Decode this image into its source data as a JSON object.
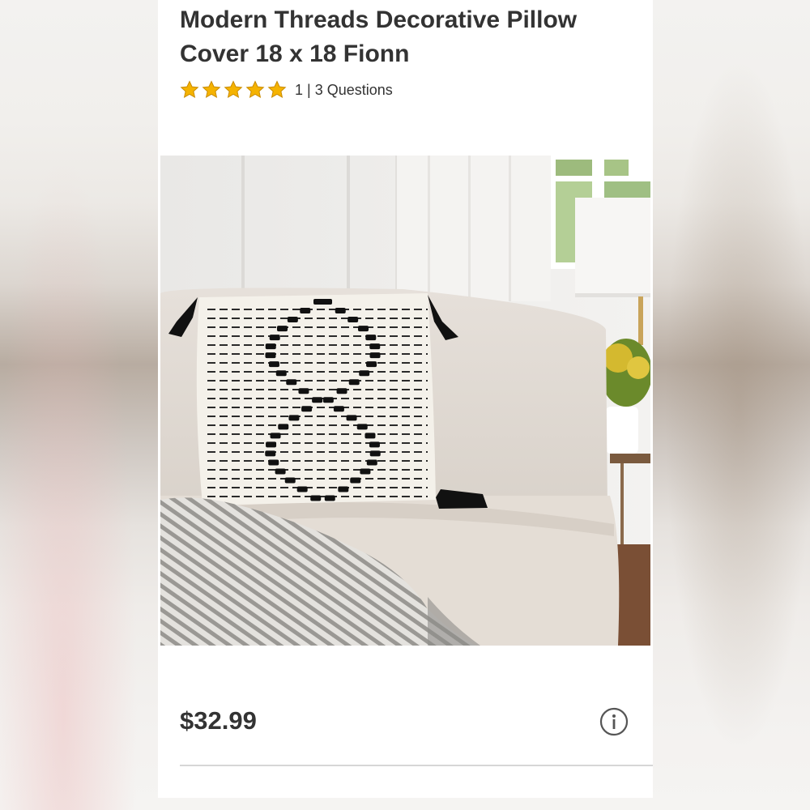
{
  "product": {
    "title": "Modern Threads Decorative Pillow Cover 18 x 18 Fionn",
    "rating": {
      "stars": 5,
      "max_stars": 5,
      "star_color": "#f5b301",
      "review_count": "1",
      "separator": "|",
      "questions_label": "3 Questions"
    },
    "price": "$32.99"
  },
  "icons": {
    "favorite": "heart-outline-icon",
    "info": "info-circle-icon"
  },
  "colors": {
    "text": "#333333",
    "divider": "#d6d6d6",
    "background": "#ffffff"
  }
}
